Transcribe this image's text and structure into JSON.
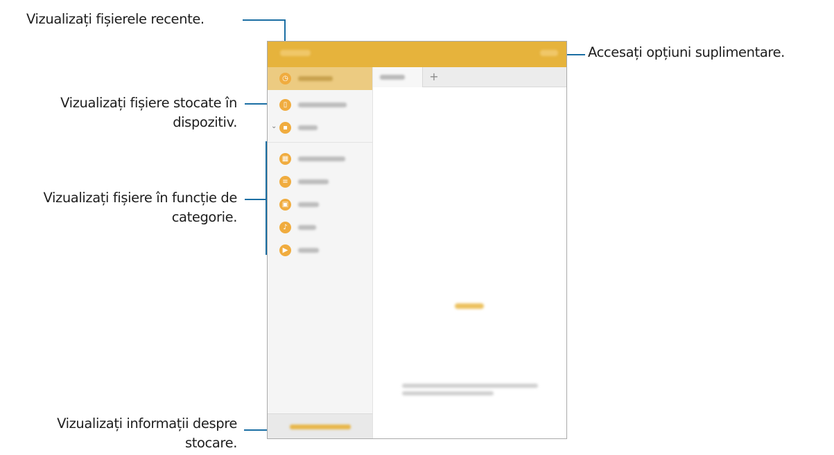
{
  "callouts": {
    "recent_files": "Vizualizați fișierele recente.",
    "device_storage_line1": "Vizualizați fișiere stocate în",
    "device_storage_line2": "dispozitiv.",
    "category_line1": "Vizualizați fișiere în funcție de",
    "category_line2": "categorie.",
    "storage_info_line1": "Vizualizați informații despre",
    "storage_info_line2": "stocare.",
    "more_options": "Accesați opțiuni suplimentare."
  },
  "tab_add_label": "+",
  "sidebar": {
    "items": [
      {
        "icon": "clock-icon",
        "glyph": "◷",
        "selected": true
      },
      {
        "icon": "device-icon",
        "glyph": "▯"
      },
      {
        "icon": "sd-card-icon",
        "glyph": "▪",
        "expandable": true
      },
      {
        "icon": "download-history-icon",
        "glyph": "▦"
      },
      {
        "icon": "document-icon",
        "glyph": "≡"
      },
      {
        "icon": "image-icon",
        "glyph": "▣"
      },
      {
        "icon": "audio-icon",
        "glyph": "♪"
      },
      {
        "icon": "video-icon",
        "glyph": "▶"
      }
    ]
  },
  "colors": {
    "accent": "#e6b33c",
    "selected_row": "#eccb81",
    "icon": "#f0ac3f",
    "callout_line": "#1a6ea3"
  }
}
